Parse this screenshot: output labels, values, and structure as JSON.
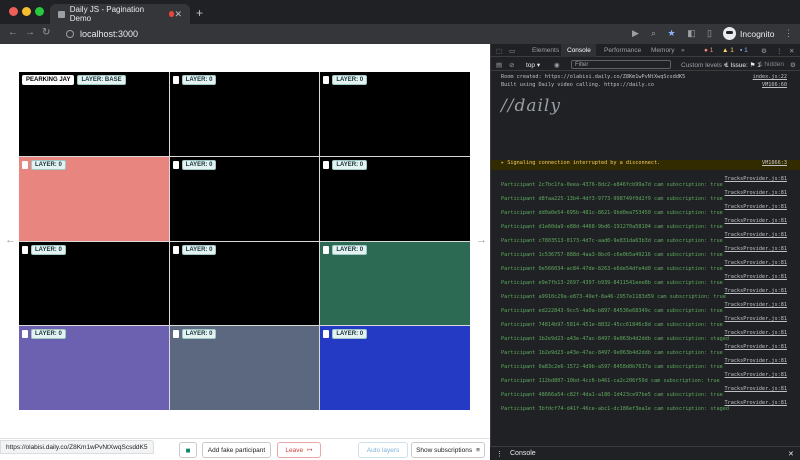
{
  "browser": {
    "tab_title": "Daily JS - Pagination Demo",
    "url": "localhost:3000",
    "profile": "Incognito",
    "traffic_colors": [
      "#ee5f57",
      "#f6be2f",
      "#29c840"
    ]
  },
  "page": {
    "tiles": [
      {
        "name": "PEARKING JAY",
        "layer": "LAYER: BASE",
        "color": "#000000"
      },
      {
        "name": "",
        "layer": "LAYER: 0",
        "color": "#000000"
      },
      {
        "name": "",
        "layer": "LAYER: 0",
        "color": "#000000"
      },
      {
        "name": "",
        "layer": "LAYER: 0",
        "color": "#e8857f"
      },
      {
        "name": "",
        "layer": "LAYER: 0",
        "color": "#000000"
      },
      {
        "name": "",
        "layer": "LAYER: 0",
        "color": "#000000"
      },
      {
        "name": "",
        "layer": "LAYER: 0",
        "color": "#000000"
      },
      {
        "name": "",
        "layer": "LAYER: 0",
        "color": "#000000"
      },
      {
        "name": "",
        "layer": "LAYER: 0",
        "color": "#2d6a54"
      },
      {
        "name": "",
        "layer": "LAYER: 0",
        "color": "#6c60b0"
      },
      {
        "name": "",
        "layer": "LAYER: 0",
        "color": "#5c6780"
      },
      {
        "name": "",
        "layer": "LAYER: 0",
        "color": "#2439c4"
      }
    ],
    "prev_arrow": "←",
    "next_arrow": "→",
    "status_url": "https://olabisi.daily.co/Z8Km1wPvNtXwqScsddK5",
    "buttons": {
      "fake": "Add fake participant",
      "leave": "Leave",
      "auto": "Auto layers",
      "subs": "Show subscriptions"
    }
  },
  "devtools": {
    "tabs": [
      "Elements",
      "Console",
      "Performance",
      "Memory"
    ],
    "active_tab": "Console",
    "errors": "1",
    "warnings": "1",
    "info": "1",
    "context": "top",
    "filter_placeholder": "Filter",
    "levels": "Custom levels ▾",
    "issues": "1 Issue: ⚑ 1",
    "hidden": "1 hidden",
    "drawer_tab": "Console",
    "lines": [
      {
        "msg": "Room created: https://olabisi.daily.co/Z8Km1wPvNtXwqScsddK5",
        "src": "index.js:22",
        "type": "log"
      },
      {
        "msg": "Built using Daily video calling. https://daily.co",
        "src": "VM166:60",
        "type": "log"
      },
      {
        "msg": "▸ Signaling connection interrupted by a disconnect.",
        "src": "VM1866:3",
        "type": "warn"
      },
      {
        "msg": "Participant 2c7bc1fa-0eea-4376-8dc2-e846fcb99a7d cam subscription: true",
        "src": "TracksProvider.js:81",
        "type": "green"
      },
      {
        "msg": "Participant d8faa225-13b4-4df3-9773-998749f0d2f9 cam subscription: true",
        "src": "TracksProvider.js:81",
        "type": "green"
      },
      {
        "msg": "Participant dd0a0e54-695b-481c-8621-9bd0ea753450 cam subscription: true",
        "src": "TracksProvider.js:81",
        "type": "green"
      },
      {
        "msg": "Participant d1e60da9-e88d-4468-9bd6-191270a58104 cam subscription: true",
        "src": "TracksProvider.js:81",
        "type": "green"
      },
      {
        "msg": "Participant c7803513-0173-4d7c-aad0-9e831da63b3d cam subscription: true",
        "src": "TracksProvider.js:81",
        "type": "green"
      },
      {
        "msg": "Participant 1c536757-888d-4aa3-8bc0-c6e0b5a49216 cam subscription: true",
        "src": "TracksProvider.js:81",
        "type": "green"
      },
      {
        "msg": "Participant 0e566034-ac84-47de-8263-e6de54dfe4d0 cam subscription: true",
        "src": "TracksProvider.js:81",
        "type": "green"
      },
      {
        "msg": "Participant e9e7fb13-2697-4397-b939-8411541eee8b cam subscription: true",
        "src": "TracksProvider.js:81",
        "type": "green"
      },
      {
        "msg": "Participant a9910c29a-e873-49ef-8a46-2957e1183d59 cam subscription: true",
        "src": "TracksProvider.js:81",
        "type": "green"
      },
      {
        "msg": "Participant ed222843-9cc5-4a0a-b897-84536e68349c cam subscription: true",
        "src": "TracksProvider.js:81",
        "type": "green"
      },
      {
        "msg": "Participant 74814b97-5814-451e-8832-45cc61846c8d cam subscription: true",
        "src": "TracksProvider.js:81",
        "type": "green"
      },
      {
        "msg": "Participant 1b2e9d23-a43e-47ac-8497-9e063b4d2ddb cam subscription: staged",
        "src": "TracksProvider.js:81",
        "type": "green"
      },
      {
        "msg": "Participant 1b2e9d23-a43e-47ac-8497-9e063b4d2ddb cam subscription: true",
        "src": "TracksProvider.js:81",
        "type": "green"
      },
      {
        "msg": "Participant 0a83c2e6-1572-4d9b-a597-8458d0b7617a cam subscription: true",
        "src": "TracksProvider.js:81",
        "type": "green"
      },
      {
        "msg": "Participant 112bd807-10bd-4cc6-b461-ca2c206f59d cam subscription: true",
        "src": "TracksProvider.js:81",
        "type": "green"
      },
      {
        "msg": "Participant 48666a54-c82f-4da1-a180-1d423ce97be5 cam subscription: true",
        "src": "TracksProvider.js:81",
        "type": "green"
      },
      {
        "msg": "Participant 3bfdcf74-d41f-46ce-abc1-dc186ef3ea1e cam subscription: staged",
        "src": "TracksProvider.js:81",
        "type": "green"
      }
    ]
  }
}
